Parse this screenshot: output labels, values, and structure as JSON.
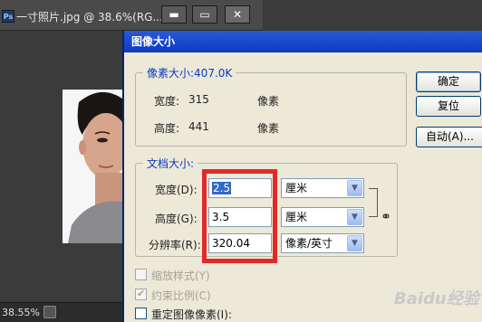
{
  "ps_window": {
    "logo_text": "Ps",
    "title": "一寸照片.jpg @ 38.6%(RG...",
    "minimize": "▬",
    "maximize": "▭",
    "close": "✕",
    "zoom": "38.55%"
  },
  "dialog": {
    "title": "图像大小",
    "pixel_group": {
      "legend": "像素大小:407.0K",
      "width_label": "宽度:",
      "width_value": "315",
      "width_unit": "像素",
      "height_label": "高度:",
      "height_value": "441",
      "height_unit": "像素"
    },
    "doc_group": {
      "legend": "文档大小:",
      "width_label": "宽度(D):",
      "width_value": "2.5",
      "width_unit": "厘米",
      "height_label": "高度(G):",
      "height_value": "3.5",
      "height_unit": "厘米",
      "resolution_label": "分辨率(R):",
      "resolution_value": "320.04",
      "resolution_unit": "像素/英寸"
    },
    "buttons": {
      "ok": "确定",
      "reset": "复位",
      "auto": "自动(A)..."
    },
    "options": {
      "scale_styles": "缩放样式(Y)",
      "constrain": "约束比例(C)",
      "resample": "重定图像像素(I):"
    }
  },
  "watermark": "Baidu经验",
  "colors": {
    "dialog_title": "#0a3bbf",
    "highlight_box": "#e02a2a",
    "selection": "#316ac5"
  }
}
